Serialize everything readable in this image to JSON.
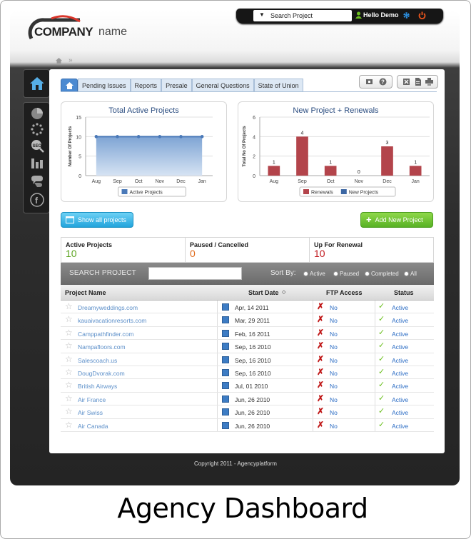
{
  "header": {
    "logo_bold": "COMPANY",
    "logo_light": "name",
    "search_placeholder": "Search Project",
    "greeting": "Hello Demo"
  },
  "breadcrumb": "»",
  "sidebar": {
    "items": [
      "home-icon",
      "pie-chart-icon",
      "loading-icon",
      "seo-icon",
      "bar-chart-icon",
      "chat-bubble-icon",
      "facebook-icon"
    ]
  },
  "tabs": [
    "Pending Issues",
    "Reports",
    "Presale",
    "General Questions",
    "State of Union"
  ],
  "chart_data": [
    {
      "type": "area",
      "title": "Total Active Projects",
      "ylabel": "Number Of Projects",
      "categories": [
        "Aug",
        "Sep",
        "Oct",
        "Nov",
        "Dec",
        "Jan"
      ],
      "yticks": [
        0,
        5,
        10,
        15
      ],
      "ylim": [
        0,
        15
      ],
      "series": [
        {
          "name": "Active Projects",
          "values": [
            10,
            10,
            10,
            10,
            10,
            10
          ],
          "color": "#4a79b8"
        }
      ],
      "legend": "bottom"
    },
    {
      "type": "bar",
      "title": "New Project + Renewals",
      "ylabel": "Total No Of Projects",
      "categories": [
        "Aug",
        "Sep",
        "Oct",
        "Nov",
        "Dec",
        "Jan"
      ],
      "yticks": [
        0,
        2,
        4,
        6
      ],
      "ylim": [
        0,
        6
      ],
      "series": [
        {
          "name": "Renewals",
          "values": [
            1,
            4,
            1,
            0,
            3,
            1
          ],
          "color": "#b3444b"
        },
        {
          "name": "New Projects",
          "values": [],
          "color": "#3b66a3"
        }
      ],
      "legend": "bottom"
    }
  ],
  "buttons": {
    "show_all": "Show all projects",
    "add_new": "Add New Project"
  },
  "stats": [
    {
      "label": "Active Projects",
      "value": "10",
      "color": "#5ba31f"
    },
    {
      "label": "Paused / Cancelled",
      "value": "0",
      "color": "#e06a1a"
    },
    {
      "label": "Up For Renewal",
      "value": "10",
      "color": "#c0161c"
    }
  ],
  "filter": {
    "label": "SEARCH PROJECT",
    "sort_by": "Sort By:",
    "options": [
      "Active",
      "Paused",
      "Completed",
      "All"
    ]
  },
  "table": {
    "headers": [
      "Project Name",
      "Start Date",
      "FTP Access",
      "Status"
    ],
    "rows": [
      {
        "name": "Dreamyweddings.com",
        "date": "Apr, 14 2011",
        "ftp": "No",
        "status": "Active"
      },
      {
        "name": "kauaivacationresorts.com",
        "date": "Mar, 29 2011",
        "ftp": "No",
        "status": "Active"
      },
      {
        "name": "Camppathfinder.com",
        "date": "Feb, 16 2011",
        "ftp": "No",
        "status": "Active"
      },
      {
        "name": "Nampafloors.com",
        "date": "Sep, 16 2010",
        "ftp": "No",
        "status": "Active"
      },
      {
        "name": "Salescoach.us",
        "date": "Sep, 16 2010",
        "ftp": "No",
        "status": "Active"
      },
      {
        "name": "DougDvorak.com",
        "date": "Sep, 16 2010",
        "ftp": "No",
        "status": "Active"
      },
      {
        "name": "British Airways",
        "date": "Jul, 01 2010",
        "ftp": "No",
        "status": "Active"
      },
      {
        "name": "Air France",
        "date": "Jun, 26 2010",
        "ftp": "No",
        "status": "Active"
      },
      {
        "name": "Air Swiss",
        "date": "Jun, 26 2010",
        "ftp": "No",
        "status": "Active"
      },
      {
        "name": "Air Canada",
        "date": "Jun, 26 2010",
        "ftp": "No",
        "status": "Active"
      }
    ]
  },
  "footer": "Copyright 2011 - Agencyplatform",
  "caption": "Agency Dashboard"
}
